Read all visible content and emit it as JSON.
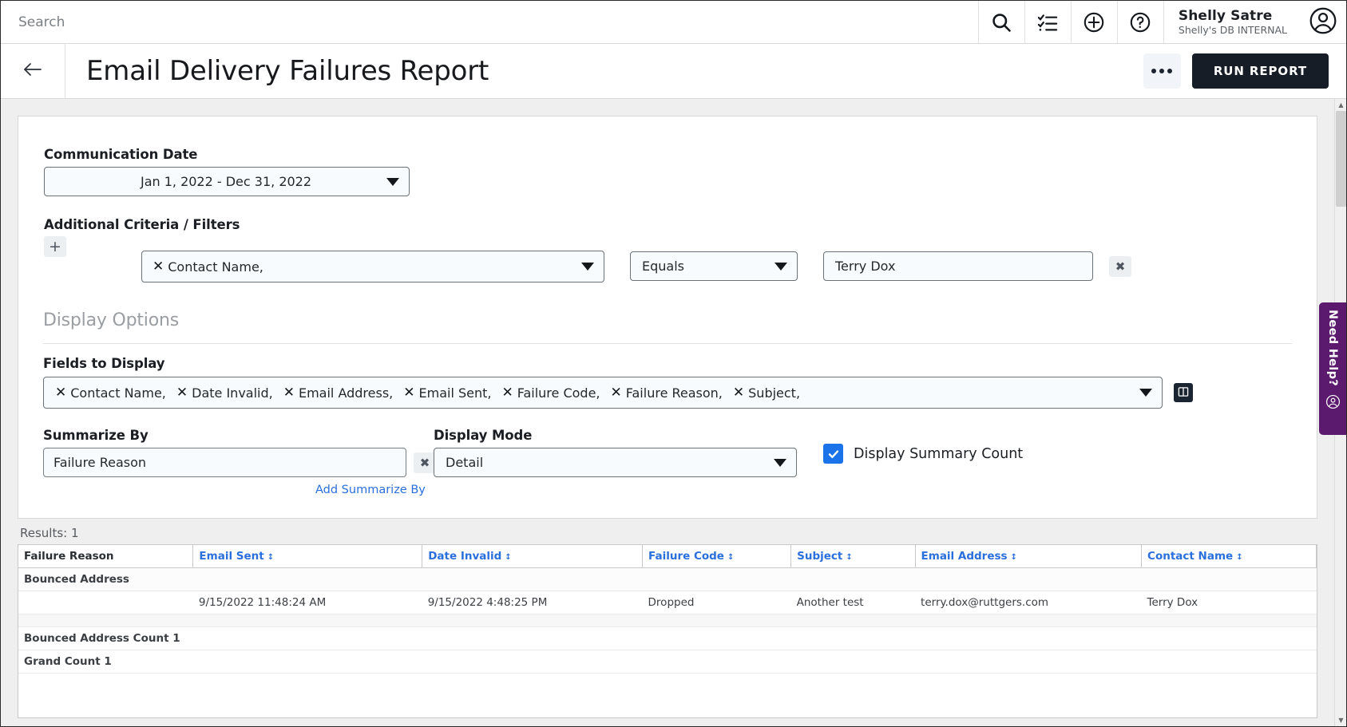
{
  "topbar": {
    "search_placeholder": "Search",
    "search_value": "",
    "icons": [
      "search-icon",
      "task-list-icon",
      "add-circle-icon",
      "help-circle-icon"
    ],
    "user_name": "Shelly Satre",
    "user_org": "Shelly's DB INTERNAL"
  },
  "titlebar": {
    "back_label": "←",
    "title": "Email Delivery Failures Report",
    "kebab_label": "•••",
    "run_label": "RUN REPORT"
  },
  "criteria": {
    "communication_date_label": "Communication Date",
    "communication_date_value": "Jan 1, 2022 - Dec 31, 2022",
    "additional_label": "Additional Criteria / Filters",
    "add_filter_label": "+",
    "remove_filter_label": "✖",
    "filter": {
      "field_chip_x": "✕",
      "field_value": "Contact Name,",
      "operator_value": "Equals",
      "value_text": "Terry Dox",
      "value_placeholder": ""
    }
  },
  "display_options": {
    "section_title": "Display Options",
    "fields_label": "Fields to Display",
    "fields": [
      "Contact Name,",
      "Date Invalid,",
      "Email Address,",
      "Email Sent,",
      "Failure Code,",
      "Failure Reason,",
      "Subject,"
    ],
    "grid_button_icon": "columns-icon",
    "summarize_label": "Summarize By",
    "summarize_value": "Failure Reason",
    "summarize_clear_label": "✖",
    "add_summarize_label": "Add Summarize By",
    "display_mode_label": "Display Mode",
    "display_mode_value": "Detail",
    "summary_count_label": "Display Summary Count",
    "summary_count_checked": true,
    "check_glyph": "✓"
  },
  "results": {
    "results_label": "Results: 1",
    "columns": [
      {
        "label": "Failure Reason",
        "sortable": false
      },
      {
        "label": "Email Sent",
        "sortable": true
      },
      {
        "label": "Date Invalid",
        "sortable": true
      },
      {
        "label": "Failure Code",
        "sortable": true
      },
      {
        "label": "Subject",
        "sortable": true
      },
      {
        "label": "Email Address",
        "sortable": true
      },
      {
        "label": "Contact Name",
        "sortable": true
      }
    ],
    "sort_glyph": "↕",
    "group_label": "Bounced Address",
    "row": {
      "failure_reason": "",
      "email_sent": "9/15/2022 11:48:24 AM",
      "date_invalid": "9/15/2022 4:48:25 PM",
      "failure_code": "Dropped",
      "subject": "Another test",
      "email_address": "terry.dox@ruttgers.com",
      "contact_name": "Terry Dox"
    },
    "group_count_label": "Bounced Address Count 1",
    "grand_count_label": "Grand Count 1"
  },
  "help_tab": {
    "label": "Need Help?",
    "icon": "person-circle-icon"
  },
  "colors": {
    "accent_blue": "#2a6fdb",
    "checkbox_blue": "#1a73e8",
    "run_button_bg": "#161d27",
    "help_purple": "#5c1a6e"
  }
}
